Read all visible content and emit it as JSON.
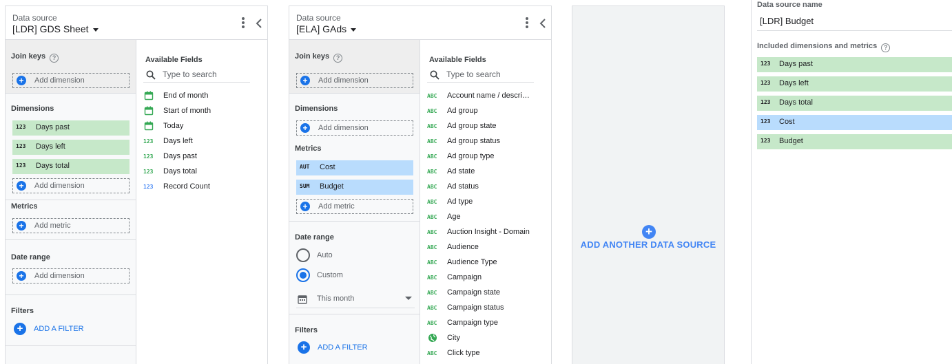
{
  "colors": {
    "accent": "#1a73e8",
    "dimension_chip": "#c6e8c9",
    "metric_chip": "#b9dcfd",
    "field_dimension_icon": "#34a853",
    "field_metric_icon": "#4285f4"
  },
  "panel1": {
    "label": "Data source",
    "name": "[LDR] GDS Sheet",
    "join_keys": {
      "title": "Join keys",
      "add": "Add dimension"
    },
    "dimensions": {
      "title": "Dimensions",
      "items": [
        {
          "tag": "123",
          "label": "Days past"
        },
        {
          "tag": "123",
          "label": "Days left"
        },
        {
          "tag": "123",
          "label": "Days total"
        }
      ],
      "add": "Add dimension"
    },
    "metrics": {
      "title": "Metrics",
      "add": "Add metric"
    },
    "date_range": {
      "title": "Date range",
      "add": "Add dimension"
    },
    "filters": {
      "title": "Filters",
      "add": "ADD A FILTER"
    },
    "available": {
      "title": "Available Fields",
      "search_placeholder": "Type to search",
      "fields": [
        {
          "icon": "calendar-icon",
          "label": "End of month"
        },
        {
          "icon": "calendar-icon",
          "label": "Start of month"
        },
        {
          "icon": "calendar-icon",
          "label": "Today"
        },
        {
          "icon": "123",
          "label": "Days left"
        },
        {
          "icon": "123",
          "label": "Days past"
        },
        {
          "icon": "123",
          "label": "Days total"
        },
        {
          "icon": "123",
          "label": "Record Count",
          "metric": true
        }
      ]
    }
  },
  "panel2": {
    "label": "Data source",
    "name": "[ELA] GAds",
    "join_keys": {
      "title": "Join keys",
      "add": "Add dimension"
    },
    "dimensions": {
      "title": "Dimensions",
      "add": "Add dimension"
    },
    "metrics": {
      "title": "Metrics",
      "items": [
        {
          "tag": "AUT",
          "label": "Cost"
        },
        {
          "tag": "SUM",
          "label": "Budget"
        }
      ],
      "add": "Add metric"
    },
    "date_range": {
      "title": "Date range",
      "options": [
        "Auto",
        "Custom"
      ],
      "selected": "Custom",
      "period": "This month"
    },
    "filters": {
      "title": "Filters",
      "add": "ADD A FILTER"
    },
    "available": {
      "title": "Available Fields",
      "search_placeholder": "Type to search",
      "fields": [
        {
          "icon": "ABC",
          "label": "Account name / descri…"
        },
        {
          "icon": "ABC",
          "label": "Ad group"
        },
        {
          "icon": "ABC",
          "label": "Ad group state"
        },
        {
          "icon": "ABC",
          "label": "Ad group status"
        },
        {
          "icon": "ABC",
          "label": "Ad group type"
        },
        {
          "icon": "ABC",
          "label": "Ad state"
        },
        {
          "icon": "ABC",
          "label": "Ad status"
        },
        {
          "icon": "ABC",
          "label": "Ad type"
        },
        {
          "icon": "ABC",
          "label": "Age"
        },
        {
          "icon": "ABC",
          "label": "Auction Insight - Domain"
        },
        {
          "icon": "ABC",
          "label": "Audience"
        },
        {
          "icon": "ABC",
          "label": "Audience Type"
        },
        {
          "icon": "ABC",
          "label": "Campaign"
        },
        {
          "icon": "ABC",
          "label": "Campaign state"
        },
        {
          "icon": "ABC",
          "label": "Campaign status"
        },
        {
          "icon": "ABC",
          "label": "Campaign type"
        },
        {
          "icon": "globe-icon",
          "label": "City"
        },
        {
          "icon": "ABC",
          "label": "Click type"
        }
      ]
    }
  },
  "add_another": {
    "label": "ADD ANOTHER DATA SOURCE"
  },
  "settings": {
    "name_label": "Data source name",
    "name_value": "[LDR] Budget",
    "included_label": "Included dimensions and metrics",
    "items": [
      {
        "tag": "123",
        "label": "Days past",
        "kind": "dimension"
      },
      {
        "tag": "123",
        "label": "Days left",
        "kind": "dimension"
      },
      {
        "tag": "123",
        "label": "Days total",
        "kind": "dimension"
      },
      {
        "tag": "123",
        "label": "Cost",
        "kind": "metric"
      },
      {
        "tag": "123",
        "label": "Budget",
        "kind": "dimension"
      }
    ]
  }
}
